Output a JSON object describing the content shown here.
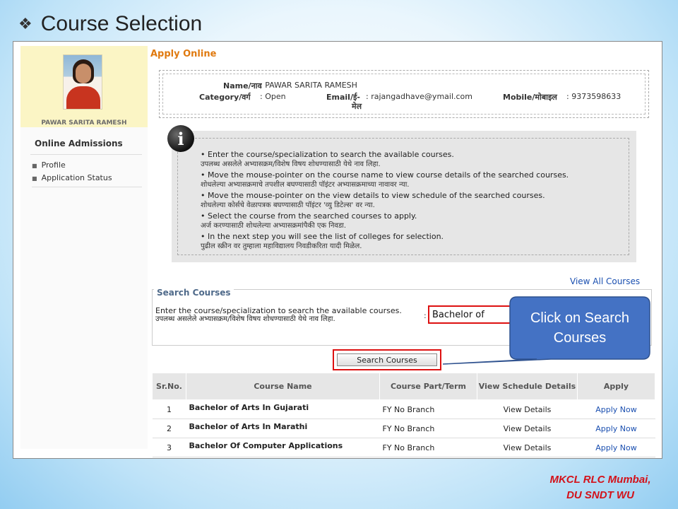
{
  "slide": {
    "title": "Course Selection",
    "bullet_icon": "diamond-bullet-icon"
  },
  "sidebar": {
    "profile_name": "PAWAR SARITA RAMESH",
    "section_title": "Online Admissions",
    "items": [
      {
        "label": "Profile"
      },
      {
        "label": "Application Status"
      }
    ]
  },
  "main": {
    "title": "Apply Online",
    "applicant": {
      "name_label": "Name/नाव",
      "name_value": ": PAWAR SARITA RAMESH",
      "category_label": "Category/वर्ग",
      "category_value": ": Open",
      "email_label": "Email/ई-",
      "email_label_line2": "मेल",
      "email_value": ": rajangadhave@ymail.com",
      "mobile_label": "Mobile/मोबाइल",
      "mobile_value": ": 9373598633"
    },
    "instructions": [
      {
        "en": "Enter the course/specialization to search the available courses.",
        "mr": "उपलब्ध असलेले अभ्यासक्रम/विशेष विषय शोधण्यासाठी येथे नाव लिहा."
      },
      {
        "en": "Move the mouse-pointer on the course name to view course details of the searched courses.",
        "mr": "शोधलेल्या अभ्यासक्रमाचे तपशील बघण्यासाठी पॉइंटर अभ्यासक्रमाच्या नावावर न्या."
      },
      {
        "en": "Move the mouse-pointer on the view details to view schedule of the searched courses.",
        "mr": "शोधलेल्या कोर्सचे वेळापत्रक बघण्यासाठी पॉइंटर 'व्यु डिटेल्स' वर न्या."
      },
      {
        "en": "Select the course from the searched courses to apply.",
        "mr": "अर्ज करण्यासाठी शोधलेल्या अभ्यासक्रमांपैकी एक निवडा."
      },
      {
        "en": "In the next step you will see the list of colleges for selection.",
        "mr": "पुढील स्क्रीन वर तुम्हाला महाविद्यालय निवडीकरिता यादी मिळेल."
      }
    ],
    "view_all_link": "View All Courses",
    "search": {
      "legend": "Search Courses",
      "desc_en": "Enter the course/specialization to search the available courses.",
      "desc_mr": "उपलब्ध असलेले अभ्यासक्रम/विशेष विषय शोधण्यासाठी येथे नाव लिहा.",
      "colon": ":",
      "input_value": "Bachelor of",
      "button_label": "Search Courses"
    },
    "table": {
      "headers": [
        "Sr.No.",
        "Course Name",
        "Course Part/Term",
        "View Schedule Details",
        "Apply"
      ],
      "rows": [
        {
          "sr": "1",
          "name": "Bachelor of Arts In Gujarati",
          "part": "FY No Branch",
          "schedule": "View Details",
          "apply": "Apply Now"
        },
        {
          "sr": "2",
          "name": "Bachelor of Arts In Marathi",
          "part": "FY No Branch",
          "schedule": "View Details",
          "apply": "Apply Now"
        },
        {
          "sr": "3",
          "name": "Bachelor Of Computer Applications",
          "part": "FY No Branch",
          "schedule": "View Details",
          "apply": "Apply Now"
        }
      ]
    }
  },
  "callout": {
    "text": "Click on Search Courses",
    "fill_color": "#4472c4"
  },
  "footer": {
    "line1": "MKCL RLC Mumbai,",
    "line2": "DU SNDT WU"
  },
  "colors": {
    "title_orange": "#e07a10",
    "highlight_red": "#dd1111",
    "link_blue": "#1a4fb0",
    "footer_red": "#d3121a"
  }
}
